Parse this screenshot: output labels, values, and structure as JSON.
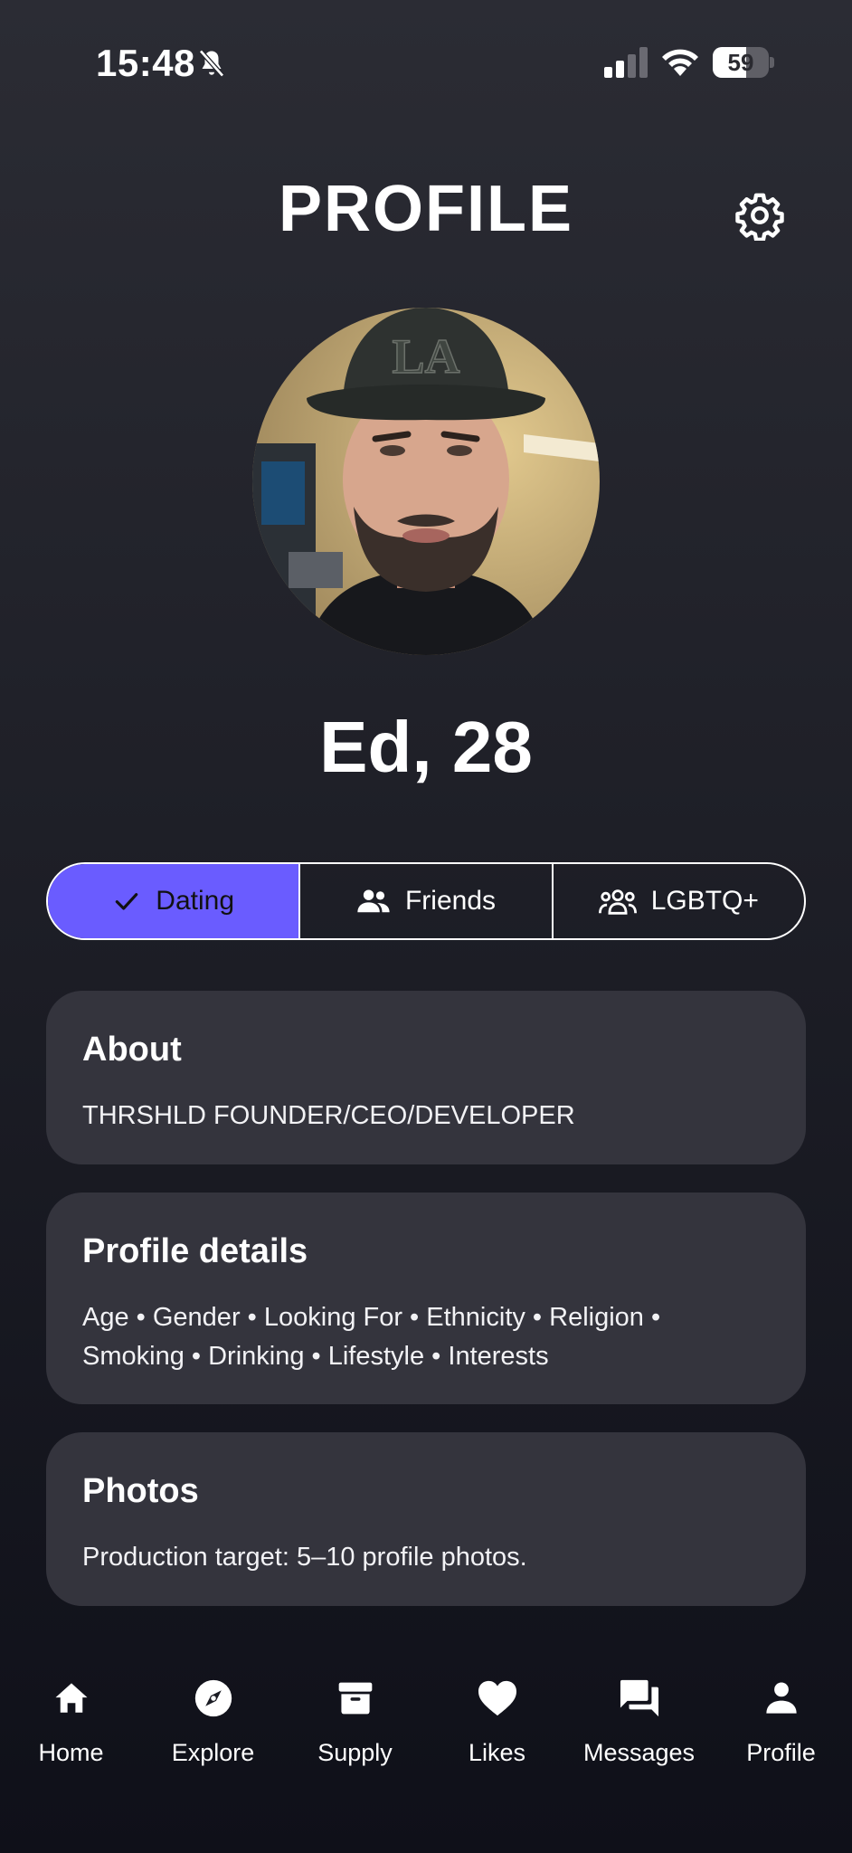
{
  "status_bar": {
    "time": "15:48",
    "battery_level": "59",
    "battery_fraction": 0.59
  },
  "header": {
    "title": "PROFILE"
  },
  "profile": {
    "name_age": "Ed, 28"
  },
  "mode_tabs": [
    {
      "label": "Dating",
      "icon": "check-icon",
      "active": true
    },
    {
      "label": "Friends",
      "icon": "people-icon",
      "active": false
    },
    {
      "label": "LGBTQ+",
      "icon": "group-icon",
      "active": false
    }
  ],
  "cards": {
    "about": {
      "title": "About",
      "text": "THRSHLD FOUNDER/CEO/DEVELOPER"
    },
    "details": {
      "title": "Profile details",
      "text": "Age • Gender • Looking For • Ethnicity • Religion • Smoking • Drinking • Lifestyle • Interests"
    },
    "photos": {
      "title": "Photos",
      "text": "Production target: 5–10 profile photos."
    }
  },
  "bottom_nav": [
    {
      "label": "Home",
      "icon": "home-icon"
    },
    {
      "label": "Explore",
      "icon": "compass-icon"
    },
    {
      "label": "Supply",
      "icon": "box-icon"
    },
    {
      "label": "Likes",
      "icon": "heart-icon"
    },
    {
      "label": "Messages",
      "icon": "chat-icon"
    },
    {
      "label": "Profile",
      "icon": "person-icon"
    }
  ],
  "colors": {
    "accent": "#6a5cff",
    "card_background": "#34343d"
  }
}
